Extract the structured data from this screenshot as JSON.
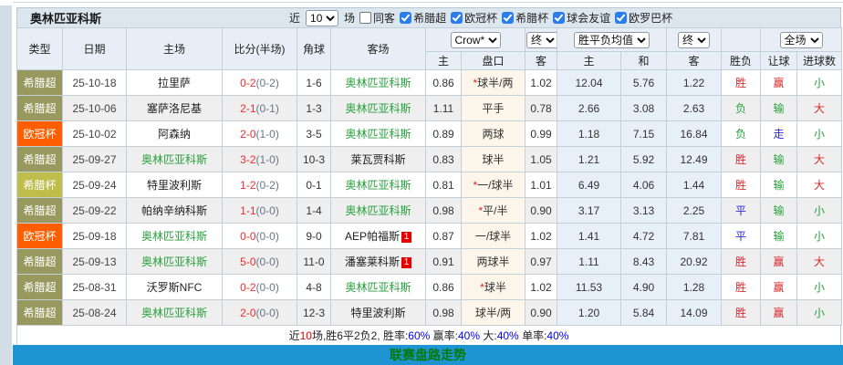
{
  "header": {
    "title": "奥林匹亚科斯",
    "recent_prefix": "近",
    "recent_select_value": "10",
    "recent_suffix": "场",
    "same_venue_label": "同客",
    "filters": [
      {
        "label": "希腊超",
        "checked": true
      },
      {
        "label": "欧冠杯",
        "checked": true
      },
      {
        "label": "希腊杯",
        "checked": true
      },
      {
        "label": "球会友谊",
        "checked": true
      },
      {
        "label": "欧罗巴杯",
        "checked": true
      }
    ]
  },
  "table": {
    "selects": {
      "bookmaker": "Crow*",
      "final1": "终",
      "avg": "胜平负均值",
      "final2": "终",
      "scope": "全场"
    },
    "columns": {
      "type": "类型",
      "date": "日期",
      "home": "主场",
      "score": "比分(半场)",
      "corners": "角球",
      "away": "客场",
      "h_home": "主",
      "h_line": "盘口",
      "h_away": "客",
      "a_win": "主",
      "a_draw": "和",
      "a_lose": "客",
      "r_outcome": "胜负",
      "r_handicap": "让球",
      "r_goals": "进球数"
    },
    "competition_types": {
      "希腊超": "super",
      "欧冠杯": "ucl",
      "希腊杯": "cup"
    },
    "rows": [
      {
        "comp": "希腊超",
        "date": "25-10-18",
        "home": "拉里萨",
        "home_target": false,
        "score_ft": "0-2",
        "score_ht": "(0-2)",
        "corners": "1-6",
        "away": "奥林匹亚科斯",
        "away_target": true,
        "away_red": "",
        "odds_home": "0.86",
        "handicap": "*球半/两",
        "odds_away": "1.02",
        "avg_win": "12.04",
        "avg_draw": "5.76",
        "avg_lose": "1.22",
        "res_outcome": "胜",
        "res_outcome_c": "red",
        "res_handicap": "赢",
        "res_handicap_c": "red",
        "res_goals": "小",
        "res_goals_c": "green"
      },
      {
        "comp": "希腊超",
        "date": "25-10-06",
        "home": "塞萨洛尼基",
        "home_target": false,
        "score_ft": "2-1",
        "score_ht": "(0-1)",
        "corners": "1-3",
        "away": "奥林匹亚科斯",
        "away_target": true,
        "away_red": "",
        "odds_home": "1.11",
        "handicap": "平手",
        "odds_away": "0.78",
        "avg_win": "2.66",
        "avg_draw": "3.08",
        "avg_lose": "2.63",
        "res_outcome": "负",
        "res_outcome_c": "green",
        "res_handicap": "输",
        "res_handicap_c": "green",
        "res_goals": "大",
        "res_goals_c": "red"
      },
      {
        "comp": "欧冠杯",
        "date": "25-10-02",
        "home": "阿森纳",
        "home_target": false,
        "score_ft": "2-0",
        "score_ht": "(1-0)",
        "corners": "3-5",
        "away": "奥林匹亚科斯",
        "away_target": true,
        "away_red": "",
        "odds_home": "0.89",
        "handicap": "两球",
        "odds_away": "0.99",
        "avg_win": "1.18",
        "avg_draw": "7.15",
        "avg_lose": "16.84",
        "res_outcome": "负",
        "res_outcome_c": "green",
        "res_handicap": "走",
        "res_handicap_c": "blue",
        "res_goals": "小",
        "res_goals_c": "green"
      },
      {
        "comp": "希腊超",
        "date": "25-09-27",
        "home": "奥林匹亚科斯",
        "home_target": true,
        "score_ft": "3-2",
        "score_ht": "(1-0)",
        "corners": "10-3",
        "away": "莱瓦贾科斯",
        "away_target": false,
        "away_red": "",
        "odds_home": "0.83",
        "handicap": "球半",
        "odds_away": "1.05",
        "avg_win": "1.21",
        "avg_draw": "5.92",
        "avg_lose": "12.49",
        "res_outcome": "胜",
        "res_outcome_c": "red",
        "res_handicap": "输",
        "res_handicap_c": "green",
        "res_goals": "大",
        "res_goals_c": "red"
      },
      {
        "comp": "希腊杯",
        "date": "25-09-24",
        "home": "特里波利斯",
        "home_target": false,
        "score_ft": "1-2",
        "score_ht": "(0-2)",
        "corners": "0-1",
        "away": "奥林匹亚科斯",
        "away_target": true,
        "away_red": "",
        "odds_home": "0.81",
        "handicap": "*一/球半",
        "odds_away": "1.01",
        "avg_win": "6.49",
        "avg_draw": "4.06",
        "avg_lose": "1.44",
        "res_outcome": "胜",
        "res_outcome_c": "red",
        "res_handicap": "输",
        "res_handicap_c": "green",
        "res_goals": "大",
        "res_goals_c": "red"
      },
      {
        "comp": "希腊超",
        "date": "25-09-22",
        "home": "帕纳辛纳科斯",
        "home_target": false,
        "score_ft": "1-1",
        "score_ht": "(0-0)",
        "corners": "1-4",
        "away": "奥林匹亚科斯",
        "away_target": true,
        "away_red": "",
        "odds_home": "0.98",
        "handicap": "*平/半",
        "odds_away": "0.90",
        "avg_win": "3.17",
        "avg_draw": "3.13",
        "avg_lose": "2.25",
        "res_outcome": "平",
        "res_outcome_c": "blue",
        "res_handicap": "输",
        "res_handicap_c": "green",
        "res_goals": "小",
        "res_goals_c": "green"
      },
      {
        "comp": "欧冠杯",
        "date": "25-09-18",
        "home": "奥林匹亚科斯",
        "home_target": true,
        "score_ft": "0-0",
        "score_ht": "(0-0)",
        "corners": "9-0",
        "away": "AEP帕福斯",
        "away_target": false,
        "away_red": "1",
        "odds_home": "0.87",
        "handicap": "一/球半",
        "odds_away": "1.02",
        "avg_win": "1.41",
        "avg_draw": "4.72",
        "avg_lose": "7.81",
        "res_outcome": "平",
        "res_outcome_c": "blue",
        "res_handicap": "输",
        "res_handicap_c": "green",
        "res_goals": "小",
        "res_goals_c": "green"
      },
      {
        "comp": "希腊超",
        "date": "25-09-13",
        "home": "奥林匹亚科斯",
        "home_target": true,
        "score_ft": "5-0",
        "score_ht": "(0-0)",
        "corners": "11-0",
        "away": "潘塞莱科斯",
        "away_target": false,
        "away_red": "1",
        "odds_home": "0.91",
        "handicap": "两球半",
        "odds_away": "0.97",
        "avg_win": "1.11",
        "avg_draw": "8.43",
        "avg_lose": "20.92",
        "res_outcome": "胜",
        "res_outcome_c": "red",
        "res_handicap": "赢",
        "res_handicap_c": "red",
        "res_goals": "大",
        "res_goals_c": "red"
      },
      {
        "comp": "希腊超",
        "date": "25-08-31",
        "home": "沃罗斯NFC",
        "home_target": false,
        "score_ft": "0-2",
        "score_ht": "(0-0)",
        "corners": "4-8",
        "away": "奥林匹亚科斯",
        "away_target": true,
        "away_red": "",
        "odds_home": "0.86",
        "handicap": "*球半",
        "odds_away": "1.02",
        "avg_win": "11.53",
        "avg_draw": "4.90",
        "avg_lose": "1.28",
        "res_outcome": "胜",
        "res_outcome_c": "red",
        "res_handicap": "赢",
        "res_handicap_c": "red",
        "res_goals": "小",
        "res_goals_c": "green"
      },
      {
        "comp": "希腊超",
        "date": "25-08-24",
        "home": "奥林匹亚科斯",
        "home_target": true,
        "score_ft": "2-0",
        "score_ht": "(0-0)",
        "corners": "12-3",
        "away": "特里波利斯",
        "away_target": false,
        "away_red": "",
        "odds_home": "0.98",
        "handicap": "球半/两",
        "odds_away": "0.90",
        "avg_win": "1.20",
        "avg_draw": "5.84",
        "avg_lose": "14.09",
        "res_outcome": "胜",
        "res_outcome_c": "red",
        "res_handicap": "赢",
        "res_handicap_c": "red",
        "res_goals": "小",
        "res_goals_c": "green"
      }
    ]
  },
  "summary": {
    "parts": [
      {
        "text": "近",
        "color": "black"
      },
      {
        "text": "10",
        "color": "red"
      },
      {
        "text": "场,胜6平2负2, 胜率:",
        "color": "black"
      },
      {
        "text": "60%",
        "color": "blue"
      },
      {
        "text": " 赢率:",
        "color": "black"
      },
      {
        "text": "40%",
        "color": "blue"
      },
      {
        "text": " 大:",
        "color": "black"
      },
      {
        "text": "40%",
        "color": "blue"
      },
      {
        "text": " 单率:",
        "color": "black"
      },
      {
        "text": "40%",
        "color": "blue"
      }
    ]
  },
  "footer": {
    "title": "联赛盘路走势"
  },
  "colors": {
    "type_super": "#97995f",
    "type_ucl": "#ff5e00",
    "type_cup": "#bfbe4d",
    "target_team_green": "#28a03c",
    "score_red": "#ee2c2c",
    "halftime_gray": "#667788",
    "result_red": "#d8282d",
    "result_green": "#28a03c",
    "result_blue": "#2929d4",
    "footer_bar_blue": "#1e94d2",
    "footer_text_green": "#067a0a",
    "checkbox_blue": "#2b7de9"
  }
}
